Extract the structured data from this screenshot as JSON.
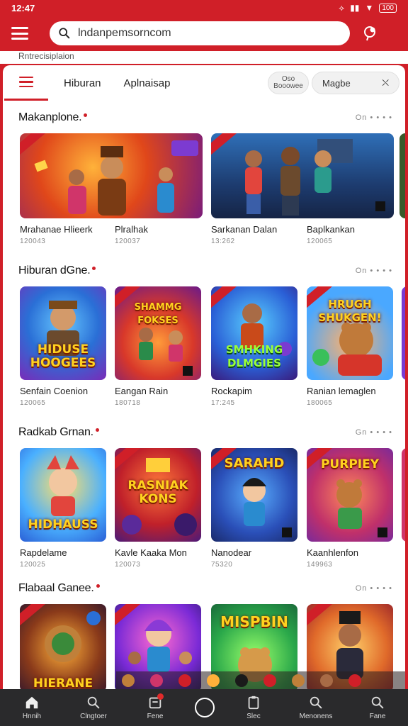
{
  "status": {
    "time": "12:47",
    "battery": "100"
  },
  "search": {
    "value": "lndanpemsorncom"
  },
  "subheader": "Rntrecisiplaion",
  "tabs": {
    "items": [
      "Hiburan",
      "Aplnaisap"
    ],
    "small_pill": "Oso\nBooowee",
    "toggle_left": "Magbe",
    "toggle_right": "⛌"
  },
  "sections": [
    {
      "title": "Makanplone.",
      "more": "On • • • •",
      "items": [
        {
          "name": "Mrahanae Hlieerk",
          "count": "120043"
        },
        {
          "name": "Plralhak",
          "count": "120037"
        },
        {
          "name": "Sarkanan Dalan",
          "count": "13:262"
        },
        {
          "name": "Baplkankan",
          "count": "120065"
        }
      ]
    },
    {
      "title": "Hiburan dGne.",
      "more": "On • • • •",
      "items": [
        {
          "name": "Senfain Coenion",
          "count": "120065",
          "headline": "HIDUSE HOOGEES"
        },
        {
          "name": "Eangan Rain",
          "count": "180718",
          "headline": "SHAMMG FOKSES"
        },
        {
          "name": "Rockapim",
          "count": "17:245",
          "headline": "SMHKING DLMGIES"
        },
        {
          "name": "Ranian lemaglen",
          "count": "180065",
          "headline": "HRUGH SHUKGEN!"
        }
      ]
    },
    {
      "title": "Radkab Grnan.",
      "more": "Gn • • • •",
      "items": [
        {
          "name": "Rapdelame",
          "count": "120025",
          "headline": "HIDHAUSS"
        },
        {
          "name": "Kavle Kaaka Mon",
          "count": "120073",
          "headline": "RASNIAK KONS"
        },
        {
          "name": "Nanodear",
          "count": "75320",
          "headline": "SARAHD"
        },
        {
          "name": "Kaanhlenfon",
          "count": "149963",
          "headline": "PURPIEY"
        }
      ]
    },
    {
      "title": "Flabaal Ganee.",
      "more": "On • • • •",
      "items": [
        {
          "name": "",
          "count": "",
          "headline": "HIERANE"
        },
        {
          "name": "",
          "count": "",
          "headline": ""
        },
        {
          "name": "",
          "count": "",
          "headline": "MISPBIN"
        },
        {
          "name": "",
          "count": "",
          "headline": ""
        }
      ]
    }
  ],
  "bottom_nav": [
    {
      "label": "Hnnih",
      "icon": "home-icon"
    },
    {
      "label": "Clngtoer",
      "icon": "search-icon"
    },
    {
      "label": "Fene",
      "icon": "inbox-icon"
    },
    {
      "label": "",
      "icon": "circle-icon"
    },
    {
      "label": "Slec",
      "icon": "clipboard-icon"
    },
    {
      "label": "Menonens",
      "icon": "search-icon"
    },
    {
      "label": "Fane",
      "icon": "search-icon"
    }
  ],
  "colors": {
    "brand": "#d01f28",
    "nav_bg": "#2a2a2c"
  }
}
